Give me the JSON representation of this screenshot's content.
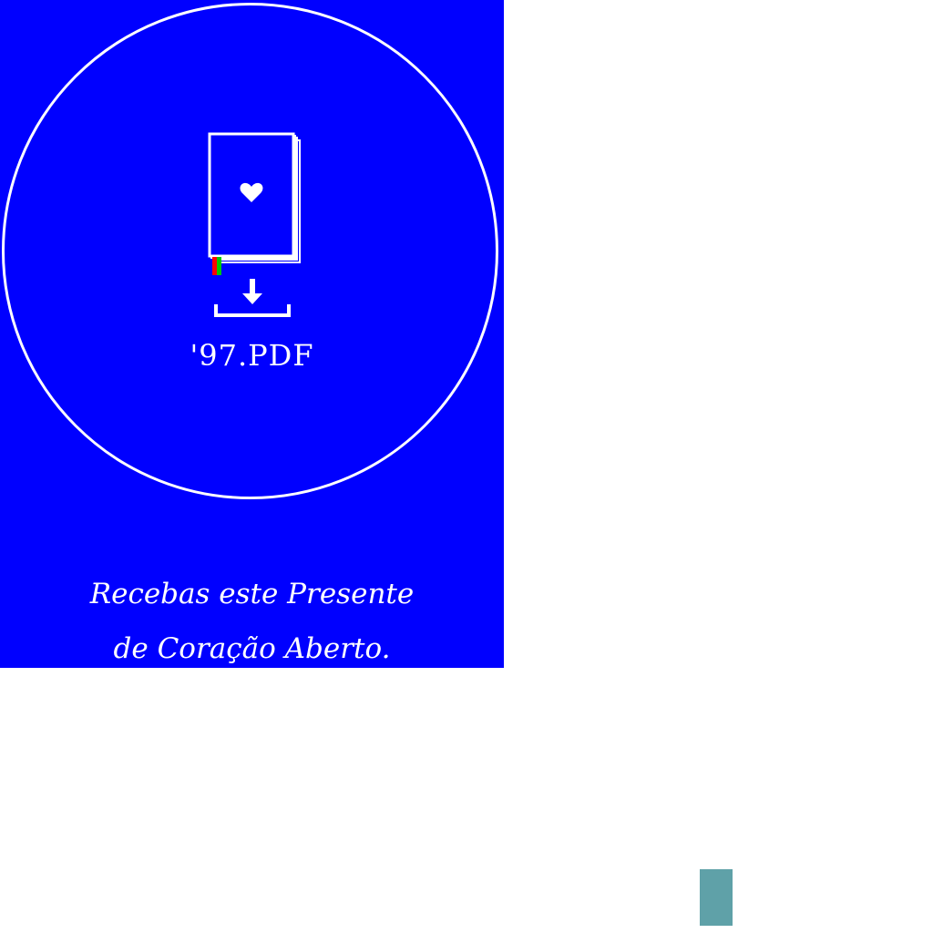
{
  "file": {
    "name": "'97.PDF"
  },
  "tagline": {
    "line1": "Recebas este Presente",
    "line2": "de Coração Aberto."
  },
  "icons": {
    "book": "book-heart-icon",
    "download": "download-icon"
  },
  "colors": {
    "poster_background": "#0000ff",
    "foreground": "#ffffff",
    "bookmark_red": "#ff0000",
    "bookmark_green": "#00c800",
    "accent_block": "#5fa1a8"
  }
}
